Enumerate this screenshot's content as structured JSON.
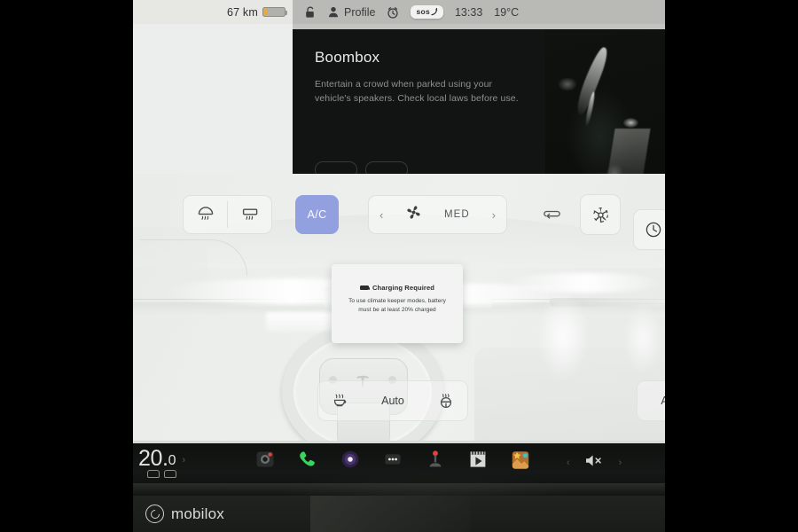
{
  "statusbar": {
    "range": "67 km",
    "battery_icon": "battery-low-icon",
    "lock_icon": "lock-icon",
    "profile_icon": "person-icon",
    "profile_label": "Profile",
    "alarm_icon": "alarm-clock-icon",
    "sos_label": "sos",
    "time": "13:33",
    "outside_temp": "19°C"
  },
  "card": {
    "title": "Boombox",
    "description": "Entertain a crowd when parked using your vehicle's speakers. Check local laws before use."
  },
  "climate": {
    "front_defrost_icon": "front-defroster-icon",
    "rear_defrost_icon": "rear-defroster-icon",
    "ac_label": "A/C",
    "fan_icon": "fan-icon",
    "fan_speed": "MED",
    "prev_chevron": "chevron-left-icon",
    "next_chevron": "chevron-right-icon",
    "recirculate_icon": "recirculate-icon",
    "bioweapon_icon": "bioweapon-defense-icon",
    "timer_icon": "clock-icon",
    "seat_heater_icon": "seat-heater-icon",
    "steering_heater_icon": "steering-wheel-heater-icon",
    "auto_label": "Auto",
    "auto_right_label": "Au"
  },
  "dialog": {
    "battery_icon": "battery-icon",
    "title": "Charging Required",
    "body": "To use climate keeper modes, battery must be at least 20% charged"
  },
  "dock": {
    "temp_integer": "20.",
    "temp_decimal": "0",
    "temp_chevron": "chevron-right-icon",
    "seat_icon": "seat-icon",
    "apps": [
      {
        "name": "dashcam-icon",
        "label": "Dashcam"
      },
      {
        "name": "phone-icon",
        "label": "Phone"
      },
      {
        "name": "media-icon",
        "label": "Media"
      },
      {
        "name": "more-icon",
        "label": "More"
      },
      {
        "name": "joystick-icon",
        "label": "Arcade"
      },
      {
        "name": "theater-icon",
        "label": "Theater"
      },
      {
        "name": "toybox-icon",
        "label": "Toybox"
      }
    ],
    "volume_prev": "chevron-left-icon",
    "volume_icon": "speaker-muted-icon",
    "volume_next": "chevron-right-icon"
  },
  "watermark": {
    "logo_icon": "mobilox-logo-icon",
    "text": "mobilox"
  },
  "colors": {
    "accent_blue": "#92a0e0",
    "battery_amber": "#eda73a",
    "phone_green": "#3ad35f",
    "screen_bg": "#eef0ee",
    "dock_bg": "#111312"
  }
}
